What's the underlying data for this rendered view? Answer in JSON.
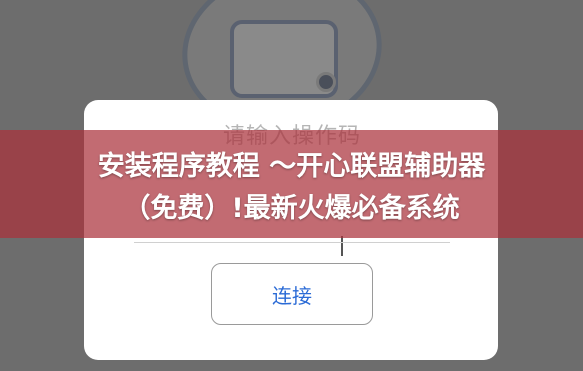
{
  "dialog": {
    "input_placeholder": "请输入操作码",
    "connect_label": "连接"
  },
  "banner": {
    "line1": "安装程序教程 ～开心联盟辅助器",
    "line2": "（免费）!最新火爆必备系统"
  },
  "colors": {
    "overlay": "#6d6d6d",
    "banner": "#aa323c",
    "button_text": "#2b6bd6"
  }
}
